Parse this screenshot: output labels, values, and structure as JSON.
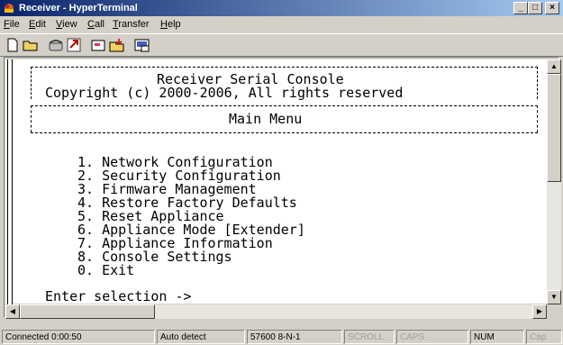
{
  "window": {
    "title": "Receiver - HyperTerminal"
  },
  "menu": [
    {
      "label": "File",
      "u": "F",
      "rest": "ile"
    },
    {
      "label": "Edit",
      "u": "E",
      "rest": "dit"
    },
    {
      "label": "View",
      "u": "V",
      "rest": "iew"
    },
    {
      "label": "Call",
      "u": "C",
      "rest": "all"
    },
    {
      "label": "Transfer",
      "u": "T",
      "rest": "ransfer"
    },
    {
      "label": "Help",
      "u": "H",
      "rest": "elp"
    }
  ],
  "toolbar": [
    "new-icon",
    "open-icon",
    "phone-icon",
    "disconnect-icon",
    "send-icon",
    "receive-icon",
    "properties-icon"
  ],
  "terminal": {
    "header_title": "Receiver Serial Console",
    "copyright": "Copyright (c) 2000-2006, All rights reserved",
    "menu_title": "Main Menu",
    "items": [
      "1. Network Configuration",
      "2. Security Configuration",
      "3. Firmware Management",
      "4. Restore Factory Defaults",
      "5. Reset Appliance",
      "6. Appliance Mode [Extender]",
      "7. Appliance Information",
      "8. Console Settings",
      "0. Exit"
    ],
    "prompt": "Enter selection ->"
  },
  "status": {
    "connected": "Connected 0:00:50",
    "detect": "Auto detect",
    "port": "57600 8-N-1",
    "scroll": "SCROLL",
    "caps": "CAPS",
    "num": "NUM",
    "cap": "Cap"
  },
  "colors": {
    "titlebar_start": "#0a246a",
    "titlebar_end": "#a6caf0",
    "chrome": "#d4d0c8"
  }
}
